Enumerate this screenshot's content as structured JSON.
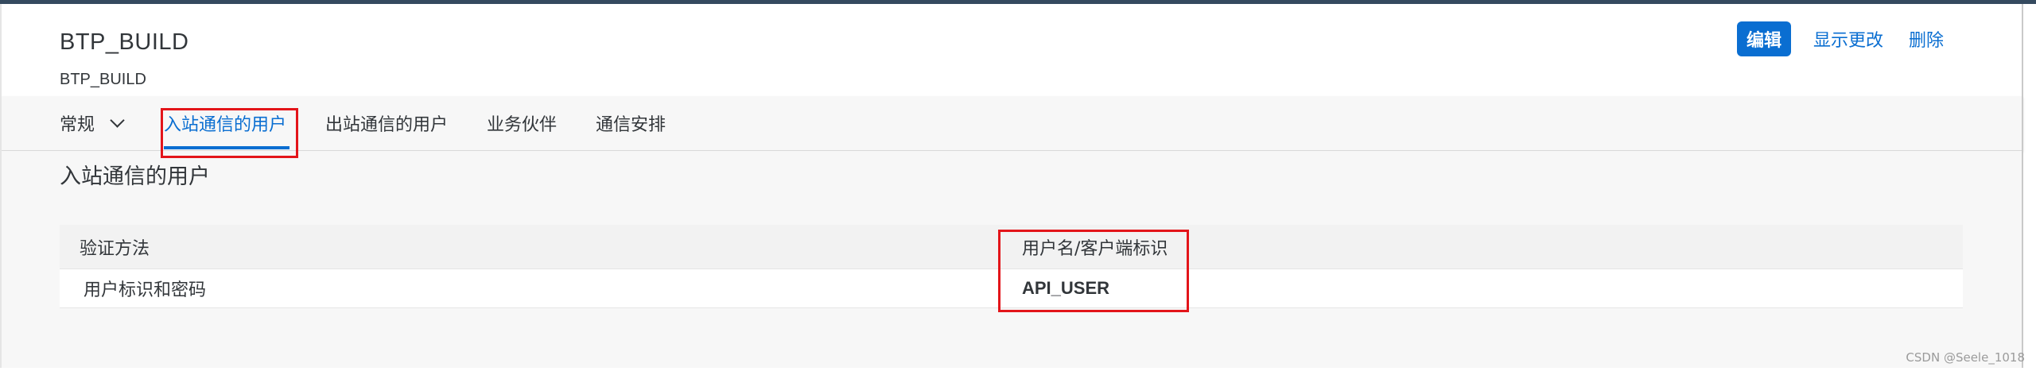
{
  "header": {
    "title": "BTP_BUILD",
    "subtitle": "BTP_BUILD"
  },
  "actions": {
    "edit_label": "编辑",
    "show_changes_label": "显示更改",
    "delete_label": "删除"
  },
  "tabs": [
    {
      "label": "常规",
      "has_dropdown": true
    },
    {
      "label": "入站通信的用户",
      "active": true
    },
    {
      "label": "出站通信的用户"
    },
    {
      "label": "业务伙伴"
    },
    {
      "label": "通信安排"
    }
  ],
  "section": {
    "title": "入站通信的用户"
  },
  "table": {
    "columns": [
      "验证方法",
      "用户名/客户端标识"
    ],
    "rows": [
      [
        "用户标识和密码",
        "API_USER"
      ]
    ]
  },
  "watermark": "CSDN @Seele_1018",
  "colors": {
    "accent": "#0a6ed1",
    "highlight_box": "#e3151a",
    "shell_bar": "#354a5f"
  }
}
